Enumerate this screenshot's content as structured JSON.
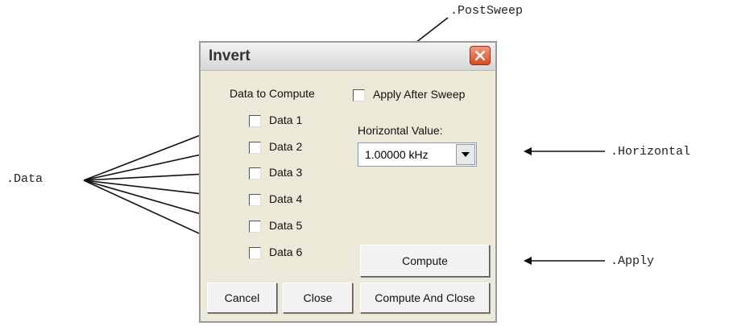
{
  "annotations": {
    "post_sweep": ".PostSweep",
    "data": ".Data",
    "horizontal": ".Horizontal",
    "apply": ".Apply"
  },
  "dialog": {
    "title": "Invert",
    "data_to_compute_label": "Data to Compute",
    "apply_after_sweep_label": "Apply After Sweep",
    "data_items": [
      "Data 1",
      "Data 2",
      "Data 3",
      "Data 4",
      "Data 5",
      "Data 6"
    ],
    "horizontal_value_label": "Horizontal Value:",
    "horizontal_value": "1.00000 kHz",
    "compute_label": "Compute",
    "cancel_label": "Cancel",
    "close_label": "Close",
    "compute_and_close_label": "Compute And Close"
  }
}
